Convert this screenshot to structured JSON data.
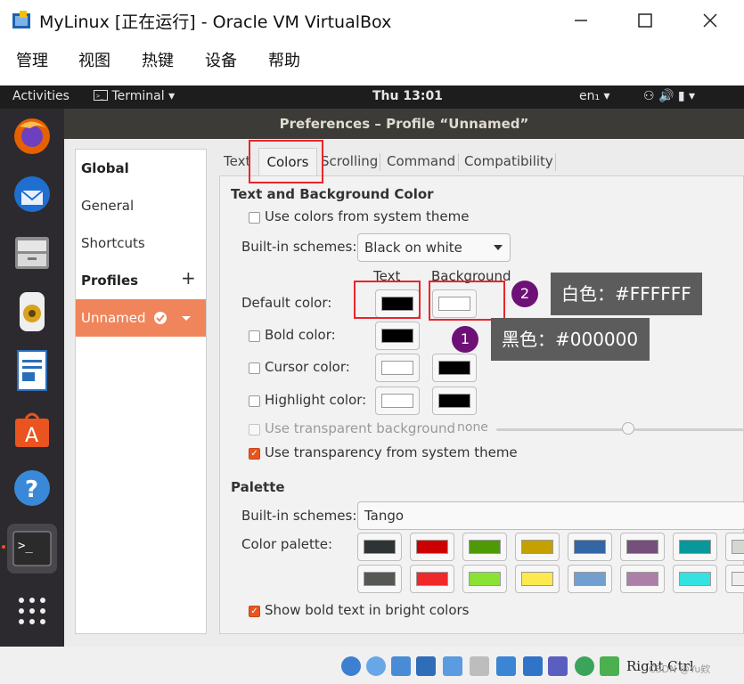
{
  "window": {
    "title": "MyLinux [正在运行] - Oracle VM VirtualBox",
    "minimize_icon": "minimize-icon",
    "maximize_icon": "maximize-icon",
    "close_icon": "close-icon"
  },
  "menubar": [
    "管理",
    "视图",
    "热键",
    "设备",
    "帮助"
  ],
  "topbar": {
    "activities": "Activities",
    "app": "Terminal ▾",
    "clock": "Thu 13:01",
    "input_method": "en₁ ▾",
    "system_icons": "⚇ 🔊 ▮ ▾"
  },
  "dock": [
    "firefox-icon",
    "thunderbird-icon",
    "files-icon",
    "rhythmbox-icon",
    "writer-icon",
    "software-icon",
    "help-icon",
    "terminal-icon",
    "app-grid-icon"
  ],
  "dialog": {
    "title": "Preferences – Profile “Unnamed”",
    "sidebar": {
      "global": "Global",
      "general": "General",
      "shortcuts": "Shortcuts",
      "profiles": "Profiles",
      "add": "+",
      "profile_name": "Unnamed"
    },
    "tabs": [
      "Text",
      "Colors",
      "Scrolling",
      "Command",
      "Compatibility"
    ],
    "active_tab": "Colors",
    "text_bg": {
      "heading": "Text and Background Color",
      "use_system": "Use colors from system theme",
      "builtin_label": "Built-in schemes:",
      "builtin_value": "Black on white",
      "col_text": "Text",
      "col_background": "Background",
      "default_color": "Default color:",
      "bold_color": "Bold color:",
      "cursor_color": "Cursor color:",
      "highlight_color": "Highlight color:",
      "transparent_bg": "Use transparent background",
      "transparency_value": "none",
      "use_transparency_system": "Use transparency from system theme",
      "swatch_black": "#000000",
      "swatch_white": "#FFFFFF"
    },
    "palette": {
      "heading": "Palette",
      "builtin_label": "Built-in schemes:",
      "builtin_value": "Tango",
      "color_palette": "Color palette:",
      "row1": [
        "#2e3436",
        "#cc0000",
        "#4e9a06",
        "#c4a000",
        "#3465a4",
        "#75507b",
        "#06989a",
        "#d3d7cf"
      ],
      "row2": [
        "#555753",
        "#ef2929",
        "#8ae234",
        "#fce94f",
        "#729fcf",
        "#ad7fa8",
        "#34e2e2",
        "#eeeeec"
      ],
      "bold_bright": "Show bold text in bright colors"
    }
  },
  "annotations": {
    "badge1": "1",
    "badge2": "2",
    "callout1": "黑色：#000000",
    "callout2": "白色：#FFFFFF"
  },
  "statusbar": {
    "hostkey": "Right Ctrl",
    "watermark": "CSDN @Yu欸"
  }
}
